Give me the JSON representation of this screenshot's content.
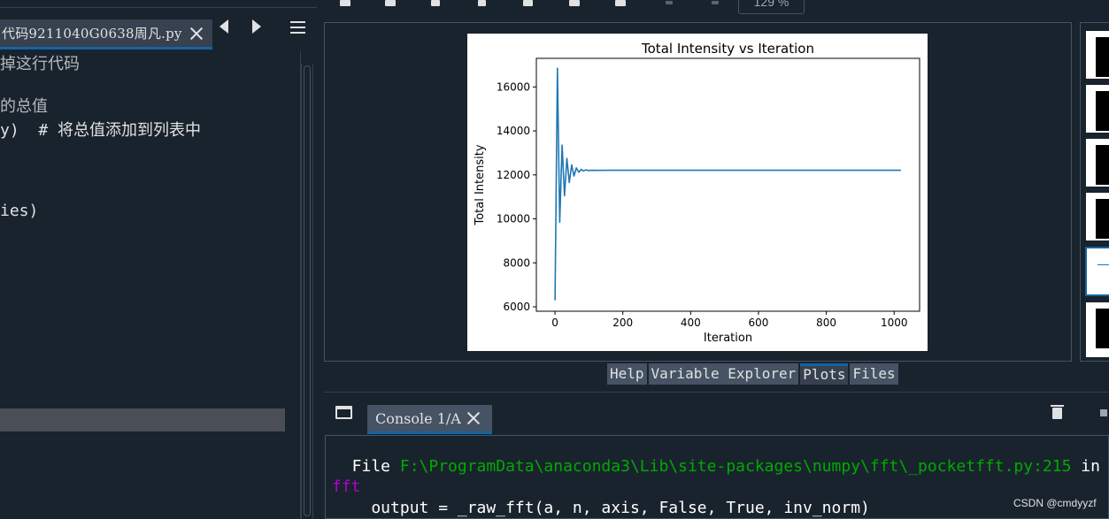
{
  "editor": {
    "tab_label": "代码9211040G0638周凡.py",
    "lines": [
      "掉这行代码",
      "的总值",
      "y)  # 将总值添加到列表中",
      "ies)"
    ]
  },
  "plots": {
    "zoom": "129 %",
    "tabs": [
      "Help",
      "Variable Explorer",
      "Plots",
      "Files"
    ],
    "active_tab": "Plots"
  },
  "console": {
    "tab_label": "Console 1/A",
    "line1_prefix": "  File ",
    "line1_path": "F:\\ProgramData\\anaconda3\\Lib\\site-packages\\numpy\\fft\\_pocketfft.py:215",
    "line1_suffix": " in",
    "line2_func": "fft",
    "line3": "    output = _raw_fft(a, n, axis, False, True, inv_norm)"
  },
  "watermark": "CSDN @cmdyyzf",
  "chart_data": {
    "type": "line",
    "title": "Total Intensity vs Iteration",
    "xlabel": "Iteration",
    "ylabel": "Total Intensity",
    "xlim": [
      -55,
      1075
    ],
    "ylim": [
      5800,
      17300
    ],
    "xticks": [
      0,
      200,
      400,
      600,
      800,
      1000
    ],
    "yticks": [
      6000,
      8000,
      10000,
      12000,
      14000,
      16000
    ],
    "color": "#1f77b4",
    "series": [
      {
        "x": [
          0,
          7,
          14,
          21,
          28,
          35,
          42,
          49,
          56,
          63,
          70,
          77,
          84,
          91,
          98,
          110,
          130,
          160,
          200,
          300,
          500,
          700,
          900,
          1020
        ],
        "y": [
          6300,
          16850,
          9850,
          13350,
          11050,
          12750,
          11650,
          12450,
          11950,
          12320,
          12120,
          12250,
          12180,
          12230,
          12200,
          12210,
          12205,
          12210,
          12210,
          12210,
          12210,
          12210,
          12210,
          12210
        ]
      }
    ]
  }
}
